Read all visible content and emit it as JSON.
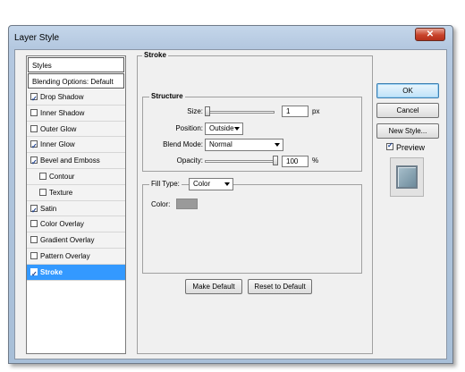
{
  "window": {
    "title": "Layer Style",
    "close_glyph": "✕"
  },
  "style_list": {
    "header": "Styles",
    "blending_options": "Blending Options: Default",
    "items": [
      {
        "label": "Drop Shadow",
        "checked": true
      },
      {
        "label": "Inner Shadow",
        "checked": false
      },
      {
        "label": "Outer Glow",
        "checked": false
      },
      {
        "label": "Inner Glow",
        "checked": true
      },
      {
        "label": "Bevel and Emboss",
        "checked": true
      },
      {
        "label": "Contour",
        "checked": false
      },
      {
        "label": "Texture",
        "checked": false
      },
      {
        "label": "Satin",
        "checked": true
      },
      {
        "label": "Color Overlay",
        "checked": false
      },
      {
        "label": "Gradient Overlay",
        "checked": false
      },
      {
        "label": "Pattern Overlay",
        "checked": false
      },
      {
        "label": "Stroke",
        "checked": true,
        "selected": true
      }
    ]
  },
  "stroke": {
    "section_title": "Stroke",
    "structure_title": "Structure",
    "size_label": "Size:",
    "size_value": "1",
    "size_unit": "px",
    "position_label": "Position:",
    "position_value": "Outside",
    "blend_mode_label": "Blend Mode:",
    "blend_mode_value": "Normal",
    "opacity_label": "Opacity:",
    "opacity_value": "100",
    "opacity_unit": "%",
    "fill_type_label": "Fill Type:",
    "fill_type_value": "Color",
    "color_label": "Color:",
    "color_value": "#9a9a9a",
    "make_default": "Make Default",
    "reset_default": "Reset to Default"
  },
  "buttons": {
    "ok": "OK",
    "cancel": "Cancel",
    "new_style": "New Style...",
    "preview_label": "Preview",
    "preview_checked": true
  },
  "colors": {
    "selection": "#3399ff",
    "default_button": "#bfe2f8",
    "close_button": "#c8432b"
  }
}
